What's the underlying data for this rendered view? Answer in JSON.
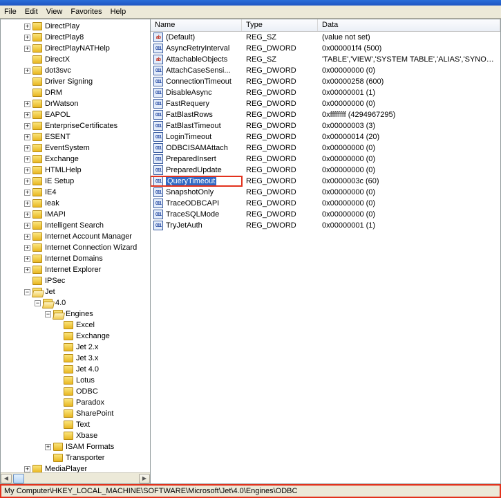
{
  "menu": {
    "file": "File",
    "edit": "Edit",
    "view": "View",
    "favorites": "Favorites",
    "help": "Help"
  },
  "tree": [
    {
      "d": 2,
      "e": "+",
      "o": 0,
      "t": "DirectPlay"
    },
    {
      "d": 2,
      "e": "+",
      "o": 0,
      "t": "DirectPlay8"
    },
    {
      "d": 2,
      "e": "+",
      "o": 0,
      "t": "DirectPlayNATHelp"
    },
    {
      "d": 2,
      "e": " ",
      "o": 0,
      "t": "DirectX"
    },
    {
      "d": 2,
      "e": "+",
      "o": 0,
      "t": "dot3svc"
    },
    {
      "d": 2,
      "e": " ",
      "o": 0,
      "t": "Driver Signing"
    },
    {
      "d": 2,
      "e": " ",
      "o": 0,
      "t": "DRM"
    },
    {
      "d": 2,
      "e": "+",
      "o": 0,
      "t": "DrWatson"
    },
    {
      "d": 2,
      "e": "+",
      "o": 0,
      "t": "EAPOL"
    },
    {
      "d": 2,
      "e": "+",
      "o": 0,
      "t": "EnterpriseCertificates"
    },
    {
      "d": 2,
      "e": "+",
      "o": 0,
      "t": "ESENT"
    },
    {
      "d": 2,
      "e": "+",
      "o": 0,
      "t": "EventSystem"
    },
    {
      "d": 2,
      "e": "+",
      "o": 0,
      "t": "Exchange"
    },
    {
      "d": 2,
      "e": "+",
      "o": 0,
      "t": "HTMLHelp"
    },
    {
      "d": 2,
      "e": "+",
      "o": 0,
      "t": "IE Setup"
    },
    {
      "d": 2,
      "e": "+",
      "o": 0,
      "t": "IE4"
    },
    {
      "d": 2,
      "e": "+",
      "o": 0,
      "t": "Ieak"
    },
    {
      "d": 2,
      "e": "+",
      "o": 0,
      "t": "IMAPI"
    },
    {
      "d": 2,
      "e": "+",
      "o": 0,
      "t": "Intelligent Search"
    },
    {
      "d": 2,
      "e": "+",
      "o": 0,
      "t": "Internet Account Manager"
    },
    {
      "d": 2,
      "e": "+",
      "o": 0,
      "t": "Internet Connection Wizard"
    },
    {
      "d": 2,
      "e": "+",
      "o": 0,
      "t": "Internet Domains"
    },
    {
      "d": 2,
      "e": "+",
      "o": 0,
      "t": "Internet Explorer"
    },
    {
      "d": 2,
      "e": " ",
      "o": 0,
      "t": "IPSec"
    },
    {
      "d": 2,
      "e": "-",
      "o": 1,
      "t": "Jet"
    },
    {
      "d": 3,
      "e": "-",
      "o": 1,
      "t": "4.0"
    },
    {
      "d": 4,
      "e": "-",
      "o": 1,
      "t": "Engines"
    },
    {
      "d": 5,
      "e": " ",
      "o": 0,
      "t": "Excel"
    },
    {
      "d": 5,
      "e": " ",
      "o": 0,
      "t": "Exchange"
    },
    {
      "d": 5,
      "e": " ",
      "o": 0,
      "t": "Jet 2.x"
    },
    {
      "d": 5,
      "e": " ",
      "o": 0,
      "t": "Jet 3.x"
    },
    {
      "d": 5,
      "e": " ",
      "o": 0,
      "t": "Jet 4.0"
    },
    {
      "d": 5,
      "e": " ",
      "o": 0,
      "t": "Lotus"
    },
    {
      "d": 5,
      "e": " ",
      "o": 0,
      "t": "ODBC"
    },
    {
      "d": 5,
      "e": " ",
      "o": 0,
      "t": "Paradox"
    },
    {
      "d": 5,
      "e": " ",
      "o": 0,
      "t": "SharePoint"
    },
    {
      "d": 5,
      "e": " ",
      "o": 0,
      "t": "Text"
    },
    {
      "d": 5,
      "e": " ",
      "o": 0,
      "t": "Xbase"
    },
    {
      "d": 4,
      "e": "+",
      "o": 0,
      "t": "ISAM Formats"
    },
    {
      "d": 4,
      "e": " ",
      "o": 0,
      "t": "Transporter"
    },
    {
      "d": 2,
      "e": "+",
      "o": 0,
      "t": "MediaPlayer"
    }
  ],
  "columns": {
    "name": "Name",
    "type": "Type",
    "data": "Data"
  },
  "values": [
    {
      "icon": "sz",
      "n": "(Default)",
      "t": "REG_SZ",
      "d": "(value not set)"
    },
    {
      "icon": "bin",
      "n": "AsyncRetryInterval",
      "t": "REG_DWORD",
      "d": "0x000001f4 (500)"
    },
    {
      "icon": "sz",
      "n": "AttachableObjects",
      "t": "REG_SZ",
      "d": "'TABLE','VIEW','SYSTEM TABLE','ALIAS','SYNONYM'"
    },
    {
      "icon": "bin",
      "n": "AttachCaseSensi...",
      "t": "REG_DWORD",
      "d": "0x00000000 (0)"
    },
    {
      "icon": "bin",
      "n": "ConnectionTimeout",
      "t": "REG_DWORD",
      "d": "0x00000258 (600)"
    },
    {
      "icon": "bin",
      "n": "DisableAsync",
      "t": "REG_DWORD",
      "d": "0x00000001 (1)"
    },
    {
      "icon": "bin",
      "n": "FastRequery",
      "t": "REG_DWORD",
      "d": "0x00000000 (0)"
    },
    {
      "icon": "bin",
      "n": "FatBlastRows",
      "t": "REG_DWORD",
      "d": "0xffffffff (4294967295)"
    },
    {
      "icon": "bin",
      "n": "FatBlastTimeout",
      "t": "REG_DWORD",
      "d": "0x00000003 (3)"
    },
    {
      "icon": "bin",
      "n": "LoginTimeout",
      "t": "REG_DWORD",
      "d": "0x00000014 (20)"
    },
    {
      "icon": "bin",
      "n": "ODBCISAMAttach",
      "t": "REG_DWORD",
      "d": "0x00000000 (0)"
    },
    {
      "icon": "bin",
      "n": "PreparedInsert",
      "t": "REG_DWORD",
      "d": "0x00000000 (0)"
    },
    {
      "icon": "bin",
      "n": "PreparedUpdate",
      "t": "REG_DWORD",
      "d": "0x00000000 (0)"
    },
    {
      "icon": "bin",
      "n": "QueryTimeout",
      "t": "REG_DWORD",
      "d": "0x0000003c (60)",
      "sel": true,
      "hl": true
    },
    {
      "icon": "bin",
      "n": "SnapshotOnly",
      "t": "REG_DWORD",
      "d": "0x00000000 (0)"
    },
    {
      "icon": "bin",
      "n": "TraceODBCAPI",
      "t": "REG_DWORD",
      "d": "0x00000000 (0)"
    },
    {
      "icon": "bin",
      "n": "TraceSQLMode",
      "t": "REG_DWORD",
      "d": "0x00000000 (0)"
    },
    {
      "icon": "bin",
      "n": "TryJetAuth",
      "t": "REG_DWORD",
      "d": "0x00000001 (1)"
    }
  ],
  "status": "My Computer\\HKEY_LOCAL_MACHINE\\SOFTWARE\\Microsoft\\Jet\\4.0\\Engines\\ODBC"
}
